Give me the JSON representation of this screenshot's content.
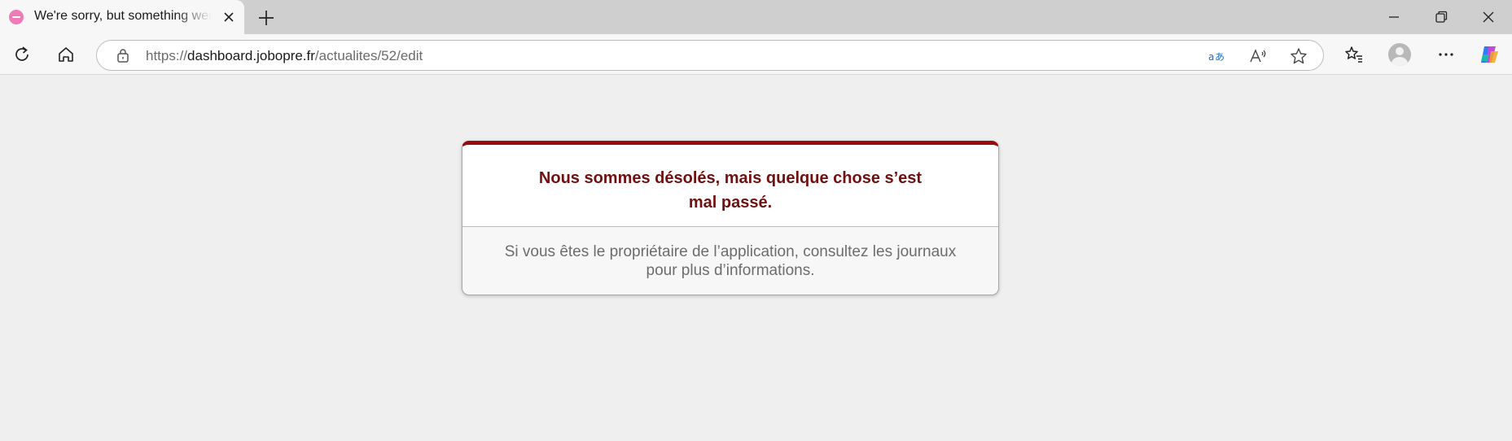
{
  "browser": {
    "tab": {
      "title": "We're sorry, but something went wrong"
    },
    "address": {
      "scheme": "https://",
      "host": "dashboard.jobopre.fr",
      "path": "/actualites/52/edit"
    },
    "colors": {
      "accent_red": "#9b0a0a",
      "title_red": "#701010",
      "favicon_pink": "#f07ab8"
    }
  },
  "error": {
    "title_line1": "Nous sommes désolés, mais quelque chose s’est",
    "title_line2": "mal passé.",
    "body_line1": "Si vous êtes le propriétaire de l’application, consultez les journaux",
    "body_line2": "pour plus d’informations."
  }
}
